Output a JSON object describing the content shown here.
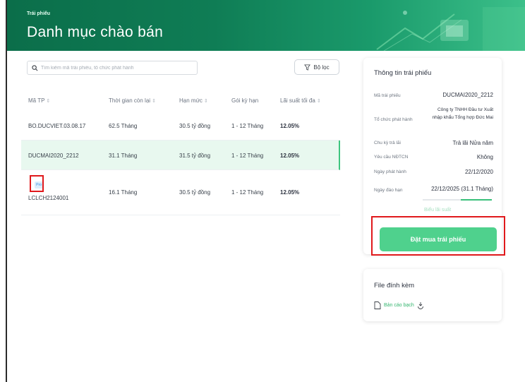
{
  "header": {
    "breadcrumb": "Trái phiếu",
    "title": "Danh mục chào bán"
  },
  "search": {
    "placeholder": "Tìm kiếm mã trái phiếu, tổ chức phát hành"
  },
  "filter": {
    "label": "Bộ lọc"
  },
  "table": {
    "columns": [
      "Mã TP",
      "Thời gian còn lại",
      "Hạn mức",
      "Gói kỳ hạn",
      "Lãi suất tối đa"
    ],
    "sort_glyph": "⇕",
    "rows": [
      {
        "code": "BO.DUCVIET.03.08.17",
        "remaining": "62.5 Tháng",
        "limit": "30.5 tỷ đồng",
        "term": "1 - 12 Tháng",
        "rate": "12.05%",
        "badge": ""
      },
      {
        "code": "DUCMAI2020_2212",
        "remaining": "31.1 Tháng",
        "limit": "31.5 tỷ đồng",
        "term": "1 - 12 Tháng",
        "rate": "12.05%",
        "badge": ""
      },
      {
        "code": "LCLCH2124001",
        "remaining": "16.1 Tháng",
        "limit": "30.5 tỷ đồng",
        "term": "1 - 12 Tháng",
        "rate": "12.05%",
        "badge": "Pro"
      }
    ]
  },
  "info": {
    "title": "Thông tin trái phiếu",
    "fields": [
      {
        "label": "Mã trái phiếu",
        "value": "DUCMAI2020_2212"
      },
      {
        "label": "Tổ chức phát hành",
        "value": "Công ty TNHH Đầu tư Xuất nhập khẩu Tổng hợp Đức Mai"
      },
      {
        "label": "Chu kỳ trả lãi",
        "value": "Trả lãi Nửa năm"
      },
      {
        "label": "Yêu cầu NĐTCN",
        "value": "Không"
      },
      {
        "label": "Ngày phát hành",
        "value": "22/12/2020"
      },
      {
        "label": "Ngày đáo hạn",
        "value": "22/12/2025 (31.1 Tháng)"
      }
    ],
    "remaining_progress": 0.45,
    "link": "Biểu lãi suất",
    "buy_button": "Đặt mua trái phiếu"
  },
  "files": {
    "title": "File đính kèm",
    "item": "Bản cáo bạch"
  },
  "colors": {
    "brand_dark": "#0b6e4a",
    "accent": "#4fd18d",
    "highlight": "#e0191c"
  }
}
